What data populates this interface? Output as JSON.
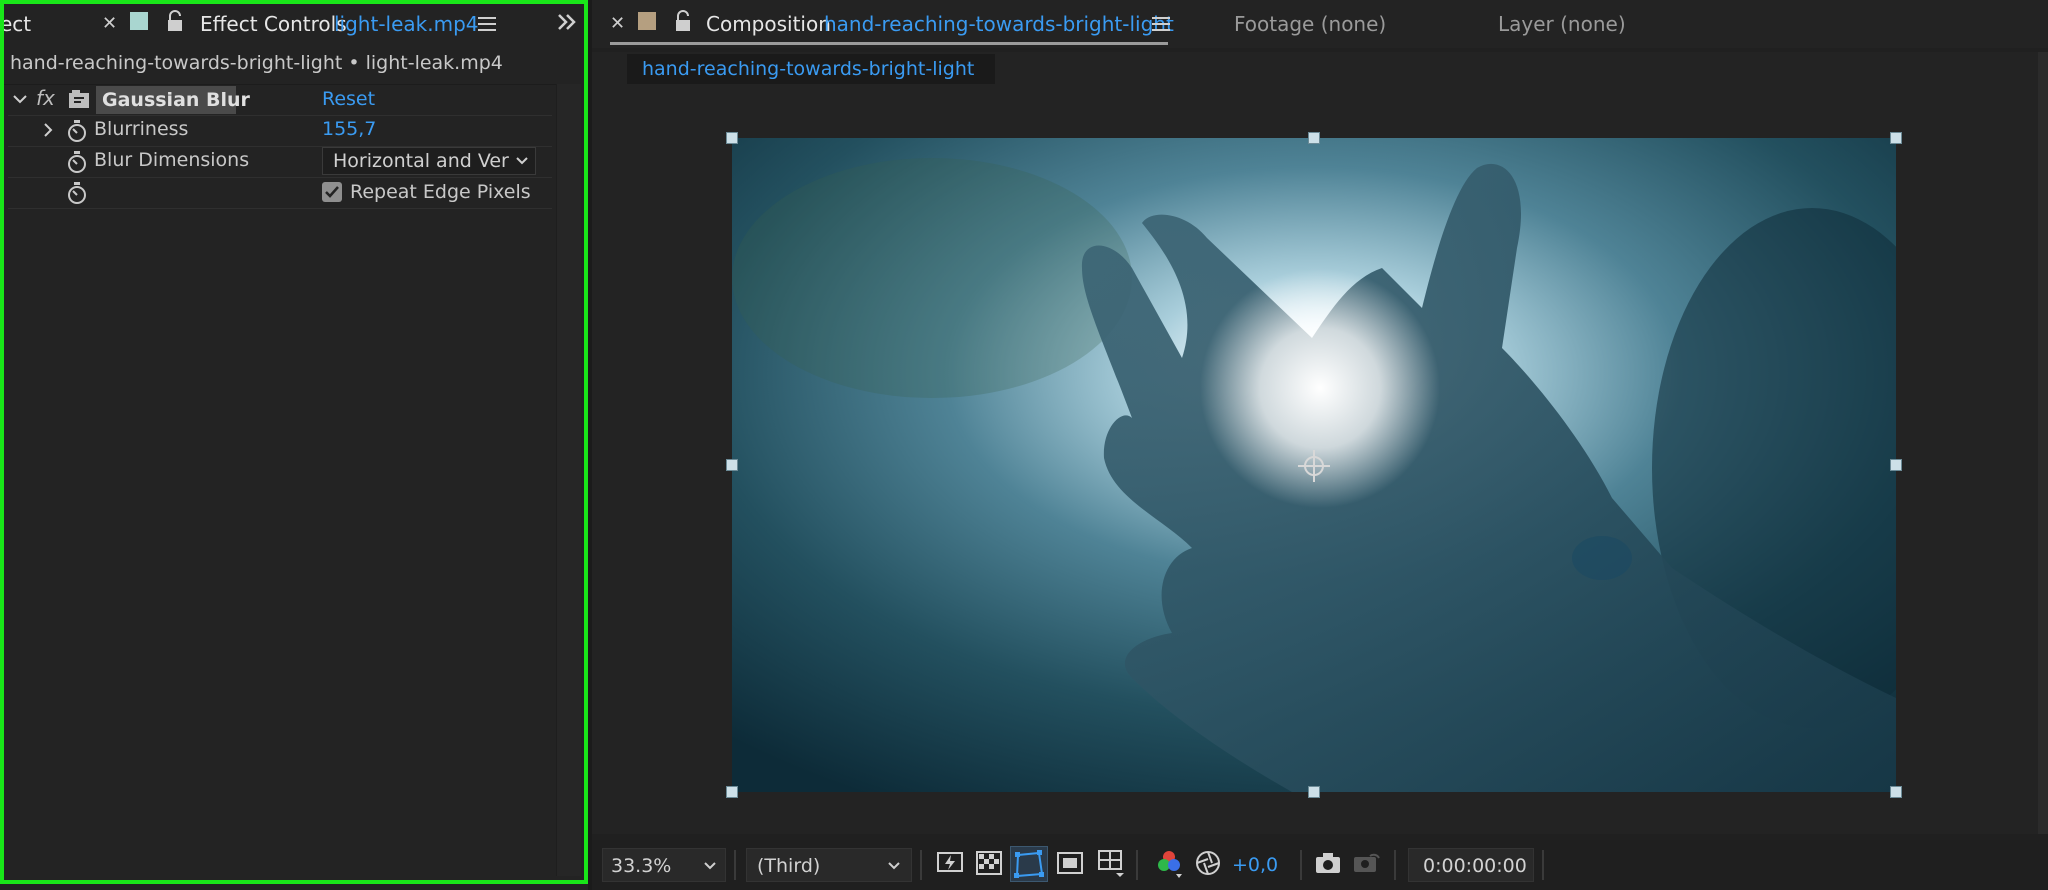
{
  "left_panel": {
    "partial_tab": "ect",
    "tab_title": "Effect Controls",
    "tab_target": "light-leak.mp4",
    "breadcrumb": "hand-reaching-towards-bright-light • light-leak.mp4",
    "effect": {
      "fx_symbol": "fx",
      "name": "Gaussian Blur",
      "reset_label": "Reset",
      "properties": [
        {
          "label": "Blurriness",
          "value": "155,7"
        },
        {
          "label": "Blur Dimensions",
          "value": "Horizontal and Vertical"
        },
        {
          "label": "Repeat Edge Pixels",
          "checked": true
        }
      ]
    }
  },
  "right_panel": {
    "tabs": [
      {
        "title": "Composition",
        "target": "hand-reaching-towards-bright-light"
      },
      {
        "title": "Footage (none)"
      },
      {
        "title": "Layer (none)"
      }
    ],
    "subtab": "hand-reaching-towards-bright-light",
    "toolbar": {
      "zoom": "33.3%",
      "resolution": "(Third)",
      "exposure": "+0,0",
      "timecode": "0:00:00:00"
    }
  },
  "colors": {
    "accent_blue": "#3a9bf2",
    "panel_highlight": "#19e619"
  }
}
